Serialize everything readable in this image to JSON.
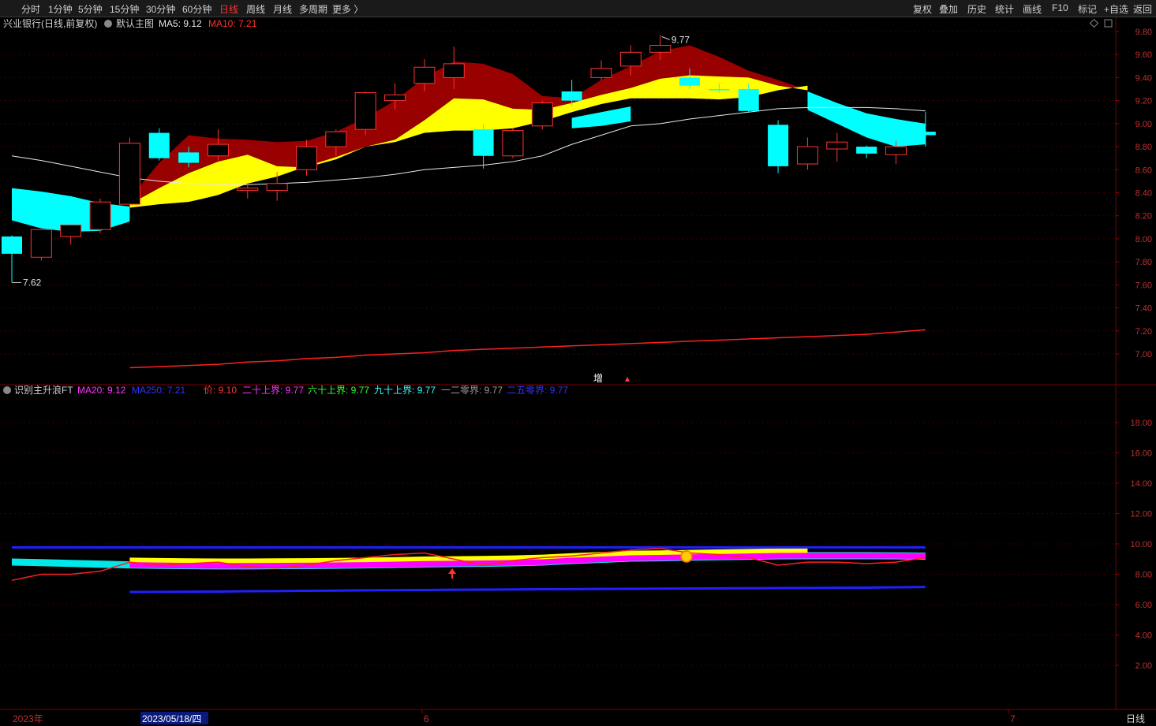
{
  "toolbar": {
    "left_items": [
      {
        "label": "分时",
        "active": false
      },
      {
        "label": "1分钟",
        "active": false
      },
      {
        "label": "5分钟",
        "active": false
      },
      {
        "label": "15分钟",
        "active": false
      },
      {
        "label": "30分钟",
        "active": false
      },
      {
        "label": "60分钟",
        "active": false
      },
      {
        "label": "日线",
        "active": true
      },
      {
        "label": "周线",
        "active": false
      },
      {
        "label": "月线",
        "active": false
      },
      {
        "label": "多周期",
        "active": false
      },
      {
        "label": "更多 〉",
        "active": false
      }
    ],
    "right_items": [
      "复权",
      "叠加",
      "历史",
      "统计",
      "画线",
      "F10",
      "标记",
      "+自选",
      "返回"
    ]
  },
  "main_panel": {
    "title": "兴业银行(日线,前复权)",
    "indicator": "默认主图",
    "ma5_label": "MA5: 9.12",
    "ma10_label": "MA10: 7.21",
    "high_label": "9.77",
    "low_label": "7.62",
    "marker_text": "增",
    "y_ticks": [
      "9.80",
      "9.60",
      "9.40",
      "9.20",
      "9.00",
      "8.80",
      "8.60",
      "8.40",
      "8.20",
      "8.00",
      "7.80",
      "7.60",
      "7.40",
      "7.20",
      "7.00"
    ]
  },
  "sub_panel": {
    "title": "识别主升浪FT",
    "legend": [
      {
        "text": "MA20: 9.12",
        "color": "#ff33ff"
      },
      {
        "text": "MA250: 7.21",
        "color": "#3333ff"
      },
      {
        "text": "价: 9.10",
        "color": "#ff3333"
      },
      {
        "text": "二十上界: 9.77",
        "color": "#ff33ff"
      },
      {
        "text": "六十上界: 9.77",
        "color": "#33ff33"
      },
      {
        "text": "九十上界: 9.77",
        "color": "#33ffff"
      },
      {
        "text": "一二零界: 9.77",
        "color": "#999999"
      },
      {
        "text": "二五零界: 9.77",
        "color": "#3333ff"
      }
    ],
    "y_ticks": [
      "18.00",
      "16.00",
      "14.00",
      "12.00",
      "10.00",
      "8.00",
      "6.00",
      "4.00",
      "2.00"
    ]
  },
  "bottom_axis": {
    "year_label": "2023年",
    "cursor_date": "2023/05/18/四",
    "month_labels": [
      "6",
      "7"
    ],
    "period_label": "日线"
  },
  "colors": {
    "up": "#ff3333",
    "down": "#00ffff",
    "band_top": "#990000",
    "band_mid": "#ffff00",
    "band_cyan": "#00ffff"
  },
  "chart_data": {
    "type": "candlestick",
    "candles": [
      {
        "o": 8.02,
        "h": 8.03,
        "l": 7.62,
        "c": 7.87
      },
      {
        "o": 7.84,
        "h": 8.08,
        "l": 7.81,
        "c": 8.08
      },
      {
        "o": 8.02,
        "h": 8.12,
        "l": 7.95,
        "c": 8.12
      },
      {
        "o": 8.08,
        "h": 8.35,
        "l": 8.05,
        "c": 8.32
      },
      {
        "o": 8.3,
        "h": 8.88,
        "l": 8.26,
        "c": 8.83
      },
      {
        "o": 8.92,
        "h": 8.96,
        "l": 8.68,
        "c": 8.7
      },
      {
        "o": 8.75,
        "h": 8.8,
        "l": 8.62,
        "c": 8.66
      },
      {
        "o": 8.72,
        "h": 8.95,
        "l": 8.68,
        "c": 8.82
      },
      {
        "o": 8.42,
        "h": 8.48,
        "l": 8.35,
        "c": 8.44
      },
      {
        "o": 8.42,
        "h": 8.58,
        "l": 8.33,
        "c": 8.48
      },
      {
        "o": 8.6,
        "h": 8.86,
        "l": 8.55,
        "c": 8.8
      },
      {
        "o": 8.8,
        "h": 8.95,
        "l": 8.72,
        "c": 8.93
      },
      {
        "o": 8.95,
        "h": 9.28,
        "l": 8.9,
        "c": 9.27
      },
      {
        "o": 9.2,
        "h": 9.35,
        "l": 9.12,
        "c": 9.25
      },
      {
        "o": 9.35,
        "h": 9.56,
        "l": 9.28,
        "c": 9.49
      },
      {
        "o": 9.4,
        "h": 9.67,
        "l": 9.3,
        "c": 9.52
      },
      {
        "o": 8.95,
        "h": 9.0,
        "l": 8.61,
        "c": 8.72
      },
      {
        "o": 8.72,
        "h": 8.96,
        "l": 8.7,
        "c": 8.94
      },
      {
        "o": 8.98,
        "h": 9.2,
        "l": 8.95,
        "c": 9.18
      },
      {
        "o": 9.28,
        "h": 9.38,
        "l": 9.15,
        "c": 9.2
      },
      {
        "o": 9.4,
        "h": 9.55,
        "l": 9.38,
        "c": 9.48
      },
      {
        "o": 9.5,
        "h": 9.68,
        "l": 9.42,
        "c": 9.62
      },
      {
        "o": 9.62,
        "h": 9.77,
        "l": 9.55,
        "c": 9.68
      },
      {
        "o": 9.4,
        "h": 9.48,
        "l": 9.3,
        "c": 9.33
      },
      {
        "o": 9.3,
        "h": 9.35,
        "l": 9.27,
        "c": 9.29
      },
      {
        "o": 9.3,
        "h": 9.35,
        "l": 9.1,
        "c": 9.11
      },
      {
        "o": 8.99,
        "h": 9.03,
        "l": 8.57,
        "c": 8.63
      },
      {
        "o": 8.65,
        "h": 8.88,
        "l": 8.6,
        "c": 8.8
      },
      {
        "o": 8.78,
        "h": 8.92,
        "l": 8.67,
        "c": 8.84
      },
      {
        "o": 8.8,
        "h": 8.81,
        "l": 8.7,
        "c": 8.74
      },
      {
        "o": 8.73,
        "h": 8.85,
        "l": 8.65,
        "c": 8.8
      },
      {
        "o": 8.93,
        "h": 9.1,
        "l": 8.8,
        "c": 8.9
      }
    ],
    "red_band_top": [
      null,
      null,
      null,
      null,
      8.35,
      8.66,
      8.9,
      8.87,
      8.86,
      8.84,
      8.85,
      8.93,
      9.05,
      9.2,
      9.4,
      9.54,
      9.52,
      9.43,
      9.24,
      9.22,
      9.38,
      9.5,
      9.63,
      9.68,
      9.58,
      9.46,
      9.38,
      9.29,
      null,
      null,
      null,
      null
    ],
    "yellow_bottom": [
      null,
      null,
      null,
      null,
      8.27,
      8.3,
      8.32,
      8.38,
      8.48,
      8.54,
      8.63,
      8.71,
      8.8,
      8.84,
      8.92,
      8.94,
      8.94,
      8.96,
      9.02,
      9.1,
      9.17,
      9.22,
      9.22,
      9.22,
      9.21,
      9.23,
      9.29,
      9.33,
      null,
      null,
      null,
      null
    ],
    "yellow_top": [
      null,
      null,
      null,
      null,
      8.3,
      8.44,
      8.57,
      8.67,
      8.73,
      8.63,
      8.62,
      8.69,
      8.8,
      8.86,
      9.03,
      9.22,
      9.21,
      9.13,
      9.12,
      9.18,
      9.25,
      9.31,
      9.39,
      9.42,
      9.41,
      9.4,
      9.33,
      9.29,
      null,
      null,
      null,
      null
    ],
    "cyan_top": [
      8.44,
      8.41,
      8.37,
      8.31,
      8.28,
      null,
      null,
      null,
      null,
      null,
      null,
      null,
      null,
      null,
      null,
      null,
      null,
      null,
      null,
      9.05,
      9.1,
      9.15,
      null,
      null,
      null,
      null,
      null,
      9.28,
      9.18,
      9.09,
      9.04,
      9.0
    ],
    "cyan_bottom": [
      8.16,
      8.09,
      8.06,
      8.07,
      8.15,
      null,
      null,
      null,
      null,
      null,
      null,
      null,
      null,
      null,
      null,
      null,
      null,
      null,
      null,
      8.96,
      8.98,
      9.02,
      null,
      null,
      null,
      null,
      null,
      9.12,
      9.0,
      8.88,
      8.8,
      8.82
    ],
    "ma_white": [
      8.72,
      8.68,
      8.63,
      8.58,
      8.53,
      8.5,
      8.48,
      8.47,
      8.47,
      8.48,
      8.49,
      8.51,
      8.53,
      8.56,
      8.6,
      8.62,
      8.64,
      8.67,
      8.72,
      8.82,
      8.9,
      8.98,
      9.0,
      9.04,
      9.07,
      9.1,
      9.13,
      9.14,
      9.14,
      9.14,
      9.13,
      9.11
    ],
    "ma250": [
      null,
      null,
      null,
      null,
      6.88,
      6.89,
      6.9,
      6.91,
      6.93,
      6.94,
      6.96,
      6.97,
      6.99,
      7.0,
      7.01,
      7.03,
      7.04,
      7.05,
      7.06,
      7.07,
      7.08,
      7.09,
      7.1,
      7.11,
      7.12,
      7.13,
      7.14,
      7.15,
      7.16,
      7.17,
      7.19,
      7.21
    ],
    "sub_price": [
      7.6,
      8.0,
      8.0,
      8.2,
      8.8,
      8.6,
      8.7,
      8.8,
      8.5,
      8.4,
      8.6,
      8.9,
      9.1,
      9.3,
      9.4,
      9.0,
      8.6,
      8.9,
      9.1,
      9.2,
      9.4,
      9.6,
      9.7,
      9.4,
      9.3,
      9.1,
      8.6,
      8.8,
      8.8,
      8.7,
      8.8,
      9.1
    ],
    "sub_upper": 9.77,
    "sub_lower": 7.21
  }
}
